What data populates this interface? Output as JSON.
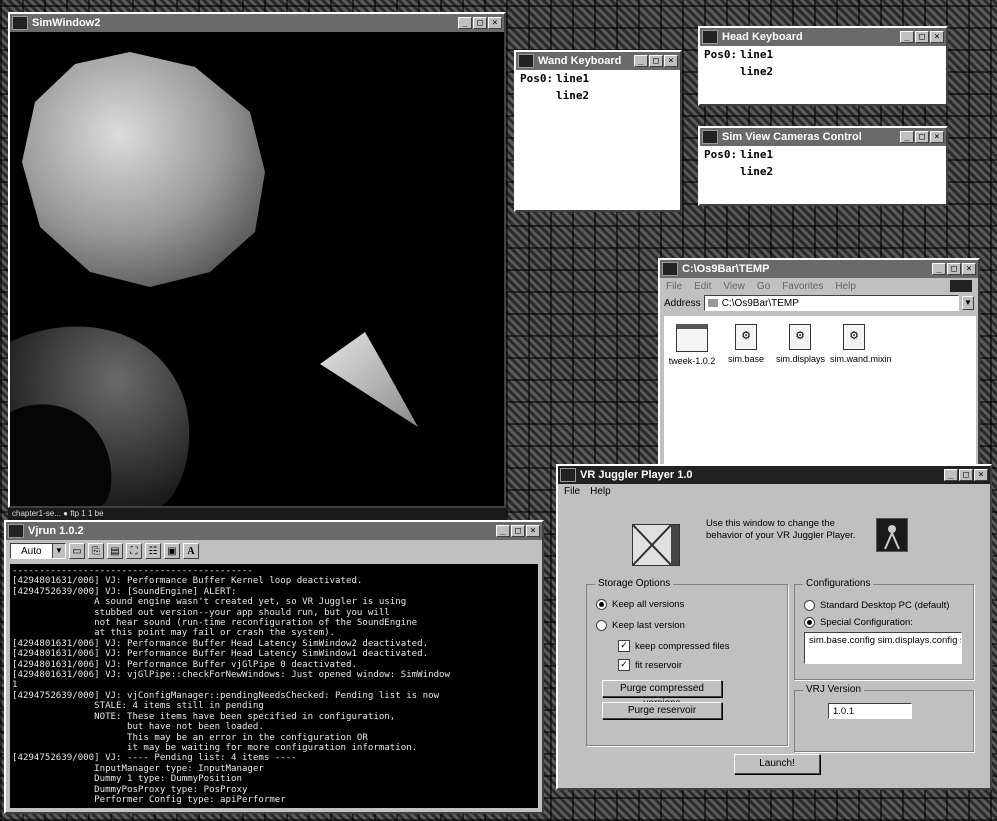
{
  "sim_window": {
    "title": "SimWindow2"
  },
  "taskbar_strip": {
    "text": "chapter1-se... ● ftp 1 1 be"
  },
  "pos_windows": [
    {
      "title": "Wand Keyboard",
      "pos_label": "Pos0:",
      "line1": "line1",
      "line2": "line2"
    },
    {
      "title": "Head Keyboard",
      "pos_label": "Pos0:",
      "line1": "line1",
      "line2": "line2"
    },
    {
      "title": "Sim View Cameras Control",
      "pos_label": "Pos0:",
      "line1": "line1",
      "line2": "line2"
    }
  ],
  "explorer": {
    "title": "C:\\Os9Bar\\TEMP",
    "menu": [
      "File",
      "Edit",
      "View",
      "Go",
      "Favorites",
      "Help"
    ],
    "address_label": "Address",
    "address_value": "C:\\Os9Bar\\TEMP",
    "files": [
      "tweek-1.0.2",
      "sim.base",
      "sim.displays",
      "sim.wand.mixin"
    ]
  },
  "console": {
    "title": "Vjrun 1.0.2",
    "zoom": "Auto",
    "font_btn": "A",
    "lines": [
      "--------------------------------------------",
      "[4294801631/006] VJ: Performance Buffer Kernel loop deactivated.",
      "[4294752639/000] VJ: [SoundEngine] ALERT:",
      "               A sound engine wasn't created yet, so VR Juggler is using",
      "               stubbed out version--your app should run, but you will",
      "               not hear sound (run-time reconfiguration of the SoundEngine",
      "               at this point may fail or crash the system).",
      "[4294801631/006] VJ: Performance Buffer Head Latency SimWindow2 deactivated.",
      "[4294801631/006] VJ: Performance Buffer Head Latency SimWindow1 deactivated.",
      "[4294801631/006] VJ: Performance Buffer vjGlPipe 0 deactivated.",
      "[4294801631/006] VJ: vjGlPipe::checkForNewWindows: Just opened window: SimWindow",
      "1",
      "[4294752639/000] VJ: vjConfigManager::pendingNeedsChecked: Pending list is now",
      "               STALE: 4 items still in pending",
      "               NOTE: These items have been specified in configuration,",
      "                     but have not been loaded.",
      "                     This may be an error in the configuration OR",
      "                     it may be waiting for more configuration information.",
      "[4294752639/000] VJ: ---- Pending list: 4 items ----",
      "               InputManager type: InputManager",
      "               Dummy 1 type: DummyPosition",
      "               DummyPosProxy type: PosProxy",
      "               Performer Config type: apiPerformer",
      "               ------------------------------------"
    ]
  },
  "vr_player": {
    "title": "VR Juggler Player 1.0",
    "menu": [
      "File",
      "Help"
    ],
    "description": "Use this window to change the behavior of your VR Juggler Player.",
    "storage_title": "Storage Options",
    "storage_options": [
      "Keep all versions",
      "Keep last version"
    ],
    "storage_selected": 0,
    "checkboxes": [
      {
        "label": "keep compressed files",
        "checked": true
      },
      {
        "label": "fit reservoir",
        "checked": true
      }
    ],
    "purge_compressed": "Purge compressed versions",
    "purge_reservoir": "Purge reservoir",
    "config_title": "Configurations",
    "config_options": [
      "Standard Desktop PC (default)",
      "Special Configuration:"
    ],
    "config_selected": 1,
    "config_value": "sim.base.config sim.displays.config si",
    "version_title": "VRJ Version",
    "version_value": "1.0.1",
    "launch_label": "Launch!"
  }
}
